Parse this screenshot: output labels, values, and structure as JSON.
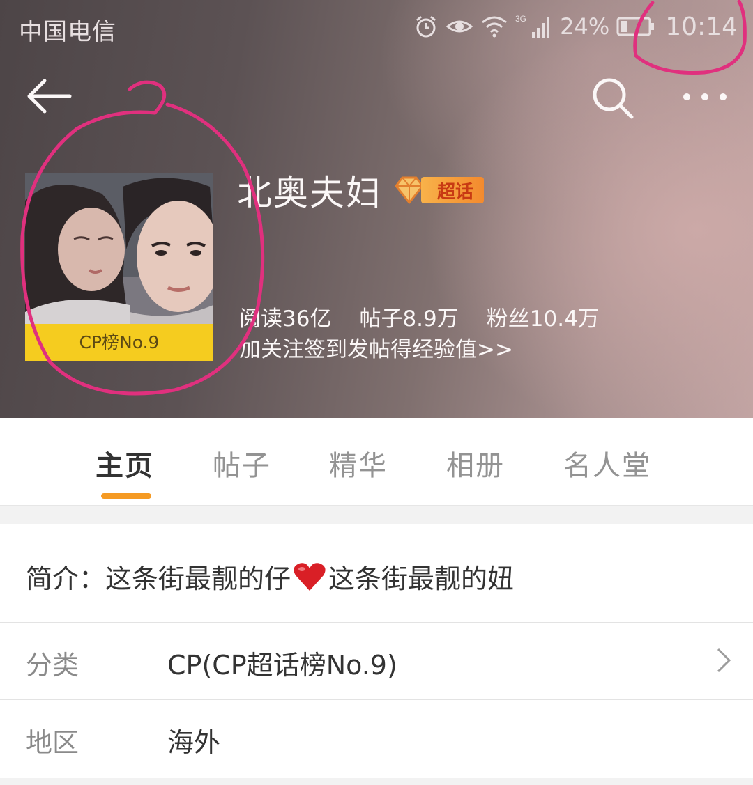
{
  "status_bar": {
    "carrier": "中国电信",
    "network": "3G",
    "battery_percent": "24%",
    "time": "10:14"
  },
  "nav": {
    "icons": [
      "back-arrow-icon",
      "search-icon",
      "more-icon"
    ]
  },
  "topic": {
    "title": "北奥夫妇",
    "super_badge": "超话",
    "avatar_badge": "CP榜No.9",
    "stats": [
      {
        "label": "阅读36亿"
      },
      {
        "label": "帖子8.9万"
      },
      {
        "label": "粉丝10.4万"
      }
    ],
    "promo": "加关注签到发帖得经验值>>"
  },
  "tabs": [
    {
      "label": "主页",
      "active": true
    },
    {
      "label": "帖子",
      "active": false
    },
    {
      "label": "精华",
      "active": false
    },
    {
      "label": "相册",
      "active": false
    },
    {
      "label": "名人堂",
      "active": false
    }
  ],
  "intro": {
    "label": "简介：",
    "part1": "这条街最靓的仔",
    "part2": "这条街最靓的妞"
  },
  "details": [
    {
      "key": "分类",
      "value": "CP(CP超话榜No.9)"
    },
    {
      "key": "地区",
      "value": "海外"
    }
  ],
  "colors": {
    "accent": "#f59a23",
    "annotation": "#e0307e",
    "badge_yellow": "#f5cc1f"
  }
}
